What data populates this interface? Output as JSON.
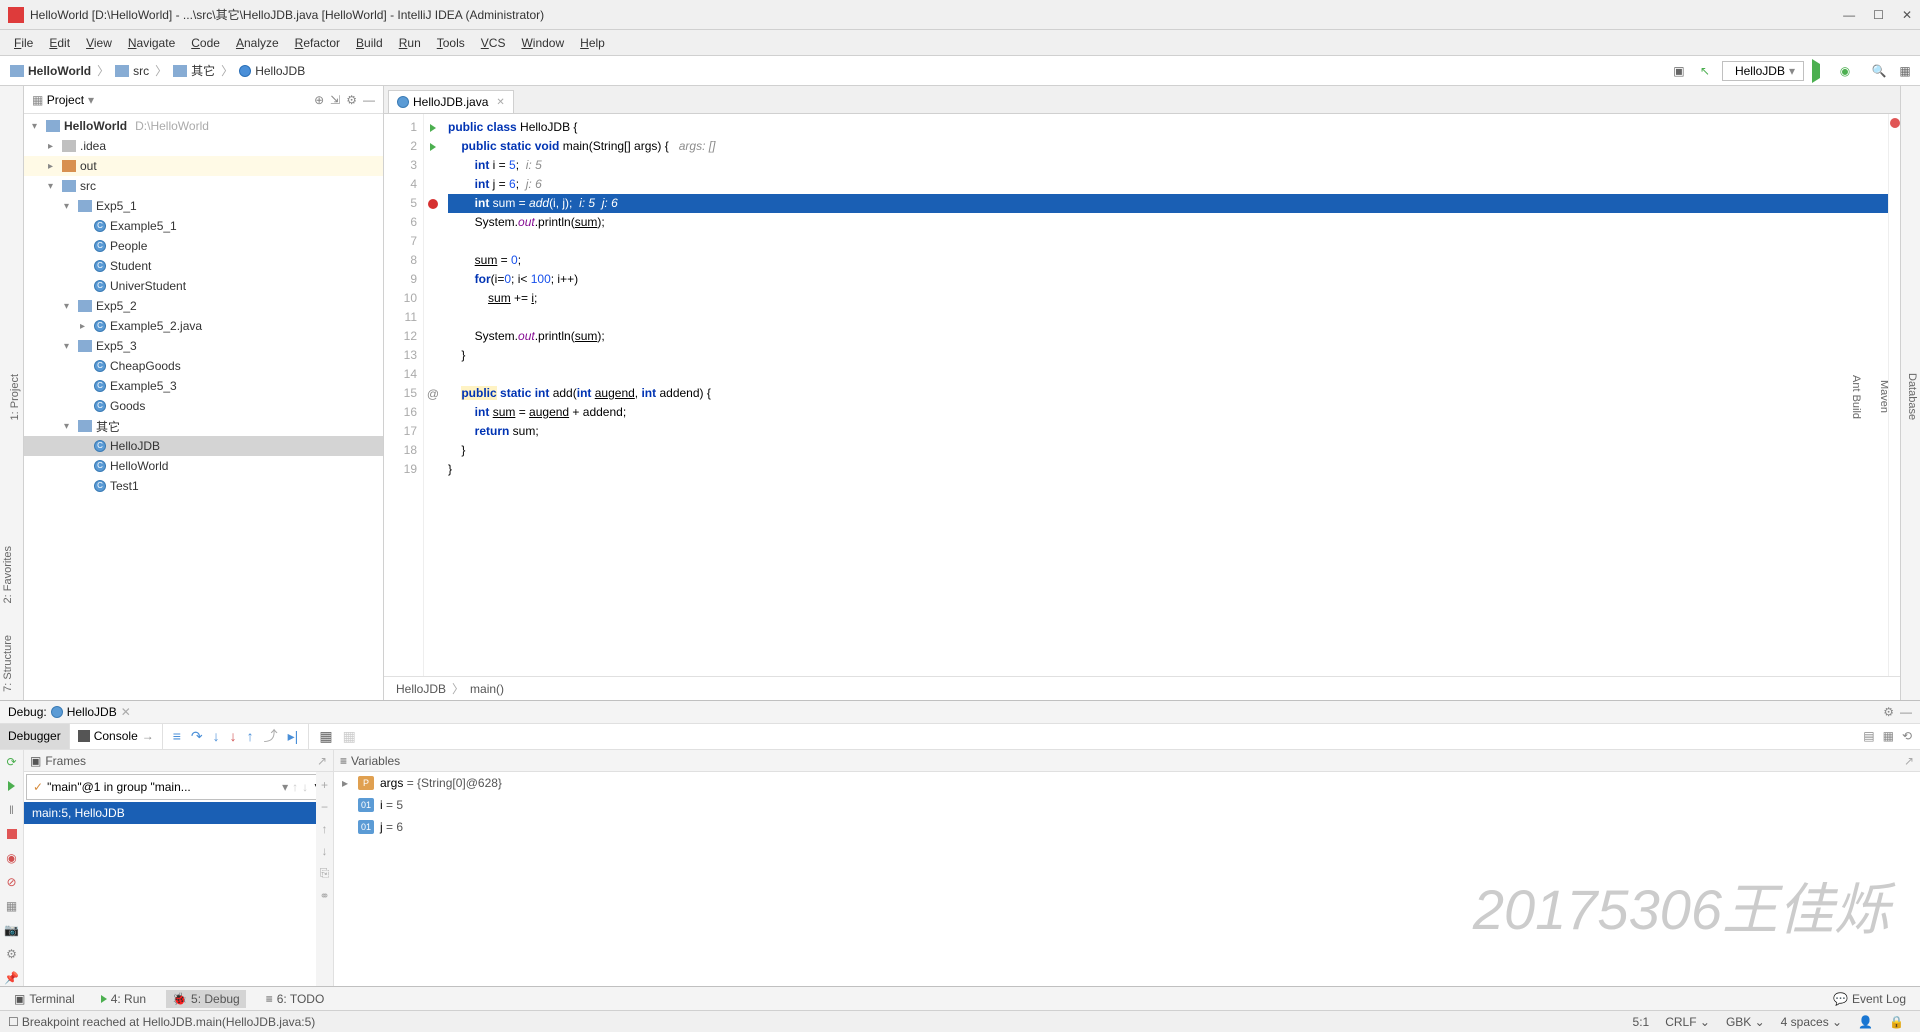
{
  "window": {
    "title": "HelloWorld [D:\\HelloWorld] - ...\\src\\其它\\HelloJDB.java [HelloWorld] - IntelliJ IDEA (Administrator)"
  },
  "menus": [
    "File",
    "Edit",
    "View",
    "Navigate",
    "Code",
    "Analyze",
    "Refactor",
    "Build",
    "Run",
    "Tools",
    "VCS",
    "Window",
    "Help"
  ],
  "breadcrumb": {
    "project": "HelloWorld",
    "src": "src",
    "pkg": "其它",
    "file": "HelloJDB"
  },
  "run_config": "HelloJDB",
  "sidebar": {
    "title": "Project",
    "tree": [
      {
        "d": 0,
        "arrow": "▾",
        "icon": "folder-blue",
        "label": "HelloWorld",
        "path": "D:\\HelloWorld",
        "bold": true
      },
      {
        "d": 1,
        "arrow": "▸",
        "icon": "folder",
        "label": ".idea"
      },
      {
        "d": 1,
        "arrow": "▸",
        "icon": "folder-orange",
        "label": "out",
        "hl": true
      },
      {
        "d": 1,
        "arrow": "▾",
        "icon": "folder-blue",
        "label": "src"
      },
      {
        "d": 2,
        "arrow": "▾",
        "icon": "folder-blue",
        "label": "Exp5_1"
      },
      {
        "d": 3,
        "arrow": "",
        "icon": "class",
        "label": "Example5_1"
      },
      {
        "d": 3,
        "arrow": "",
        "icon": "class",
        "label": "People"
      },
      {
        "d": 3,
        "arrow": "",
        "icon": "class",
        "label": "Student"
      },
      {
        "d": 3,
        "arrow": "",
        "icon": "class",
        "label": "UniverStudent"
      },
      {
        "d": 2,
        "arrow": "▾",
        "icon": "folder-blue",
        "label": "Exp5_2"
      },
      {
        "d": 3,
        "arrow": "▸",
        "icon": "class",
        "label": "Example5_2.java"
      },
      {
        "d": 2,
        "arrow": "▾",
        "icon": "folder-blue",
        "label": "Exp5_3"
      },
      {
        "d": 3,
        "arrow": "",
        "icon": "class",
        "label": "CheapGoods"
      },
      {
        "d": 3,
        "arrow": "",
        "icon": "class",
        "label": "Example5_3"
      },
      {
        "d": 3,
        "arrow": "",
        "icon": "class",
        "label": "Goods"
      },
      {
        "d": 2,
        "arrow": "▾",
        "icon": "folder-blue",
        "label": "其它"
      },
      {
        "d": 3,
        "arrow": "",
        "icon": "class",
        "label": "HelloJDB",
        "sel": true
      },
      {
        "d": 3,
        "arrow": "",
        "icon": "class",
        "label": "HelloWorld"
      },
      {
        "d": 3,
        "arrow": "",
        "icon": "class",
        "label": "Test1"
      }
    ]
  },
  "left_tools": [
    "1: Project",
    "2: Favorites",
    "7: Structure"
  ],
  "right_tools": [
    "Database",
    "Maven",
    "Ant Build"
  ],
  "editor": {
    "tab": "HelloJDB.java",
    "lines": [
      {
        "n": 1,
        "icon": "run",
        "html": "<span class='kw'>public</span> <span class='kw'>class</span> HelloJDB {"
      },
      {
        "n": 2,
        "icon": "run",
        "html": "    <span class='kw'>public static void</span> main(String[] args) {   <span class='cm'>args: []</span>"
      },
      {
        "n": 3,
        "icon": "",
        "html": "        <span class='kw'>int</span> i = <span class='nm'>5</span>;  <span class='cm'>i: 5</span>"
      },
      {
        "n": 4,
        "icon": "",
        "html": "        <span class='kw'>int</span> j = <span class='nm'>6</span>;  <span class='cm'>j: 6</span>"
      },
      {
        "n": 5,
        "icon": "bp",
        "hl": true,
        "html": "        <span class='kw'>int</span> sum = <span class='fn'>add</span>(i, j);  <span class='cm'>i: 5  j: 6</span>"
      },
      {
        "n": 6,
        "icon": "",
        "html": "        System.<span class='fld'>out</span>.println(<u>sum</u>);"
      },
      {
        "n": 7,
        "icon": "",
        "html": ""
      },
      {
        "n": 8,
        "icon": "",
        "html": "        <u>sum</u> = <span class='nm'>0</span>;"
      },
      {
        "n": 9,
        "icon": "",
        "html": "        <span class='kw'>for</span>(i=<span class='nm'>0</span>; i&lt; <span class='nm'>100</span>; i++)"
      },
      {
        "n": 10,
        "icon": "",
        "html": "            <u>sum</u> += <u>i</u>;"
      },
      {
        "n": 11,
        "icon": "",
        "html": ""
      },
      {
        "n": 12,
        "icon": "",
        "html": "        System.<span class='fld'>out</span>.println(<u>sum</u>);"
      },
      {
        "n": 13,
        "icon": "",
        "html": "    }"
      },
      {
        "n": 14,
        "icon": "",
        "html": ""
      },
      {
        "n": 15,
        "icon": "ov",
        "html": "    <span style='background:#fff3c4'><span class='kw'>public</span></span> <span class='kw'>static int</span> add(<span class='kw'>int</span> <u>augend</u>, <span class='kw'>int</span> addend) {"
      },
      {
        "n": 16,
        "icon": "",
        "html": "        <span class='kw'>int</span> <u>sum</u> = <u>augend</u> + addend;"
      },
      {
        "n": 17,
        "icon": "",
        "html": "        <span class='kw'>return</span> sum;"
      },
      {
        "n": 18,
        "icon": "",
        "html": "    }"
      },
      {
        "n": 19,
        "icon": "",
        "html": "}"
      }
    ],
    "crumb1": "HelloJDB",
    "crumb2": "main()"
  },
  "debug": {
    "title": "Debug:",
    "config": "HelloJDB",
    "tabs": [
      "Debugger",
      "Console"
    ],
    "frames_title": "Frames",
    "vars_title": "Variables",
    "thread": "\"main\"@1 in group \"main...",
    "frame": "main:5, HelloJDB",
    "vars": [
      {
        "badge": "p",
        "name": "args",
        "val": "= {String[0]@628}",
        "expand": true
      },
      {
        "badge": "i",
        "name": "i",
        "val": "= 5"
      },
      {
        "badge": "i",
        "name": "j",
        "val": "= 6"
      }
    ]
  },
  "watermark": "20175306王佳烁",
  "bottom": {
    "terminal": "Terminal",
    "run": "4: Run",
    "debug": "5: Debug",
    "todo": "6: TODO",
    "eventlog": "Event Log"
  },
  "status": {
    "msg": "Breakpoint reached at HelloJDB.main(HelloJDB.java:5)",
    "pos": "5:1",
    "crlf": "CRLF",
    "enc": "GBK",
    "indent": "4 spaces"
  }
}
